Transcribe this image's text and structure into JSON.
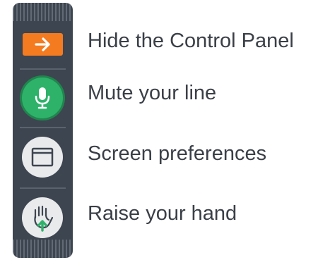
{
  "control_panel": {
    "items": [
      {
        "label": "Hide the Control Panel",
        "icon": "arrow-right-icon",
        "color": "#f47b20"
      },
      {
        "label": "Mute your line",
        "icon": "microphone-icon",
        "color": "#2eb26a"
      },
      {
        "label": "Screen preferences",
        "icon": "window-icon",
        "color": "#e9eaec"
      },
      {
        "label": "Raise your hand",
        "icon": "raise-hand-icon",
        "color": "#e9eaec"
      }
    ]
  }
}
